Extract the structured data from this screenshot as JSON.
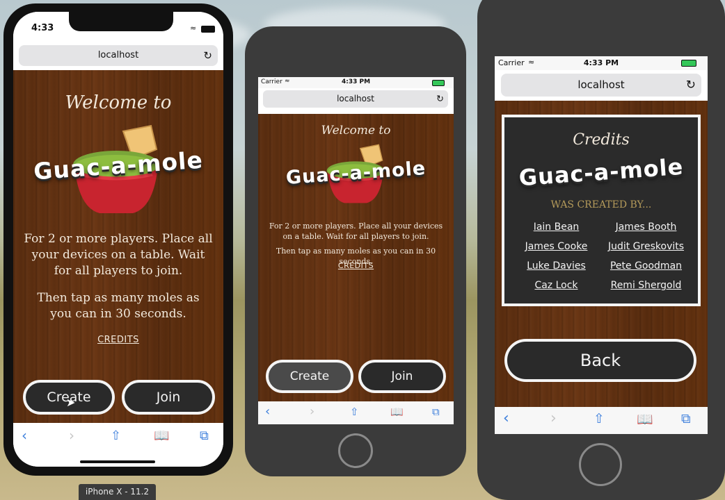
{
  "app": {
    "name": "Guac-a-mole"
  },
  "device_label": "iPhone X - 11.2",
  "phone1": {
    "time": "4:33",
    "url": "localhost",
    "welcome": "Welcome to",
    "logo": "Guac-a-mole",
    "desc1": "For 2 or more players. Place all your devices on a table. Wait for all players to join.",
    "desc2": "Then tap as many moles as you can in 30 seconds.",
    "credits_link": "CREDITS",
    "create_label": "Create",
    "join_label": "Join"
  },
  "phone2": {
    "carrier": "Carrier",
    "time": "4:33 PM",
    "url": "localhost",
    "welcome": "Welcome to",
    "logo": "Guac-a-mole",
    "desc1": "For 2 or more players. Place all your devices on a table. Wait for all players to join.",
    "desc2": "Then tap as many moles as you can in 30 seconds.",
    "credits_link": "CREDITS",
    "create_label": "Create",
    "join_label": "Join"
  },
  "phone3": {
    "carrier": "Carrier",
    "time": "4:33 PM",
    "url": "localhost",
    "credits_title": "Credits",
    "logo": "Guac-a-mole",
    "created_by": "WAS CREATED BY...",
    "names": [
      "Iain Bean",
      "James Booth",
      "James Cooke",
      "Judit Greskovits",
      "Luke Davies",
      "Pete Goodman",
      "Caz Lock",
      "Remi Shergold"
    ],
    "back_label": "Back"
  },
  "toolbar_icons": [
    "back-icon",
    "forward-icon",
    "share-icon",
    "bookmarks-icon",
    "tabs-icon"
  ],
  "colors": {
    "wood": "#5f3112",
    "button": "#2a2a2a",
    "ios_blue": "#3d7fdc",
    "credits_gold": "#b49a5a"
  }
}
